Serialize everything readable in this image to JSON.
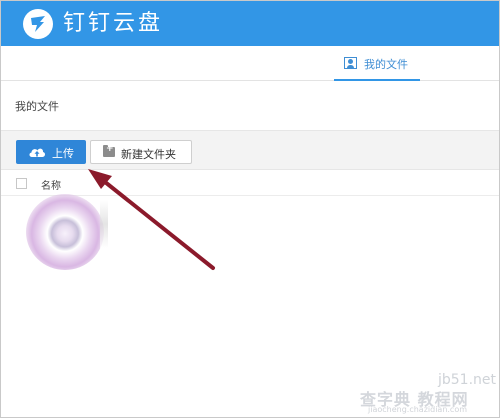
{
  "header": {
    "app_title": "钉钉云盘",
    "logo_icon": "dingtalk-logo-icon",
    "background": "#3296e6"
  },
  "tabs": [
    {
      "label": "我的文件",
      "icon": "user-card-icon",
      "active": true
    }
  ],
  "breadcrumb": "我的文件",
  "toolbar": {
    "upload_label": "上传",
    "upload_icon": "cloud-upload-icon",
    "new_folder_label": "新建文件夹",
    "new_folder_icon": "folder-plus-icon",
    "accent": "#2f86d8"
  },
  "file_list": {
    "columns": [
      "名称"
    ],
    "loading": true
  },
  "annotation": {
    "arrow_color": "#8b1a2b",
    "points_to": "upload-button"
  },
  "watermark": {
    "line1": "jb51.net",
    "line2": "查字典 教程网",
    "line3": "jiaocheng.chazidian.com"
  }
}
